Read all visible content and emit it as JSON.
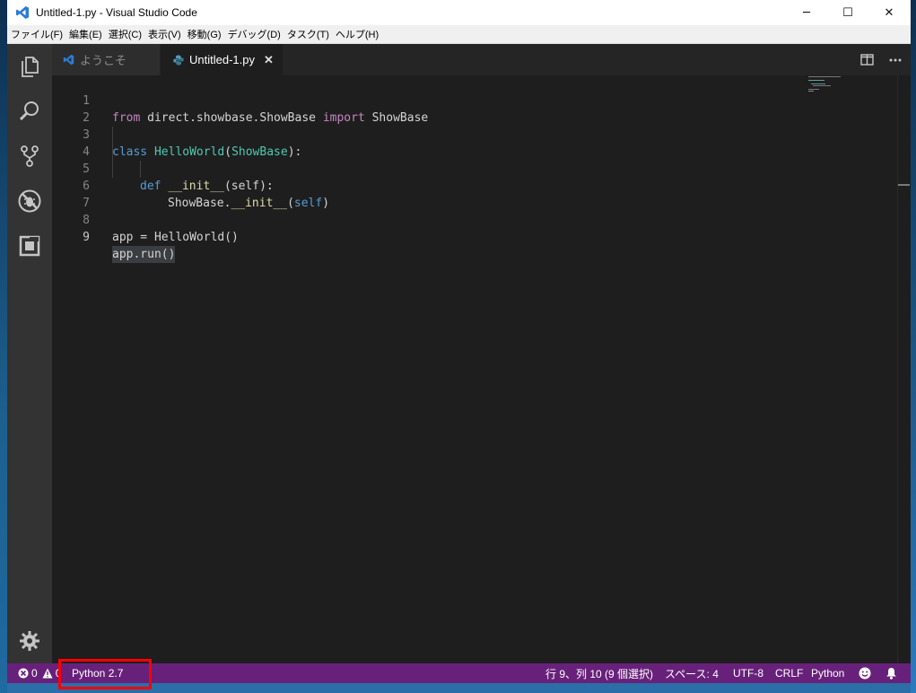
{
  "window": {
    "title": "Untitled-1.py - Visual Studio Code",
    "minimize": "─",
    "maximize": "☐",
    "close": "✕"
  },
  "menu": [
    "ファイル(F)",
    "編集(E)",
    "選択(C)",
    "表示(V)",
    "移動(G)",
    "デバッグ(D)",
    "タスク(T)",
    "ヘルプ(H)"
  ],
  "tabs": {
    "welcome": "ようこそ",
    "active": "Untitled-1.py",
    "close_glyph": "✕"
  },
  "editor": {
    "line_numbers": [
      "1",
      "2",
      "3",
      "4",
      "5",
      "6",
      "7",
      "8",
      "9"
    ],
    "code": {
      "l1_from": "from",
      "l1_module": " direct.showbase.ShowBase ",
      "l1_import": "import",
      "l1_name": " ShowBase",
      "l3_class": "class",
      "l3_name": "HelloWorld",
      "l3_paren_open": "(",
      "l3_base": "ShowBase",
      "l3_paren_close": "):",
      "l5_def": "def",
      "l5_fn": "__init__",
      "l5_args_open": "(",
      "l5_self": "self",
      "l5_args_close": "):",
      "l6_call": "ShowBase.",
      "l6_fn": "__init__",
      "l6_open": "(",
      "l6_self": "self",
      "l6_close": ")",
      "l8_text": "app = HelloWorld()",
      "l9_text": "app.run()"
    }
  },
  "statusbar": {
    "errors": "0",
    "warnings": "0",
    "interpreter": "Python 2.7",
    "cursor": "行 9、列 10 (9 個選択)",
    "spaces": "スペース: 4",
    "encoding": "UTF-8",
    "eol": "CRLF",
    "language": "Python",
    "bg_color": "#68217a"
  },
  "icons": {
    "explorer": "files-icon",
    "search": "search-icon",
    "scm": "source-control-icon",
    "debug": "debug-icon",
    "extensions": "extensions-icon",
    "settings": "gear-icon"
  }
}
